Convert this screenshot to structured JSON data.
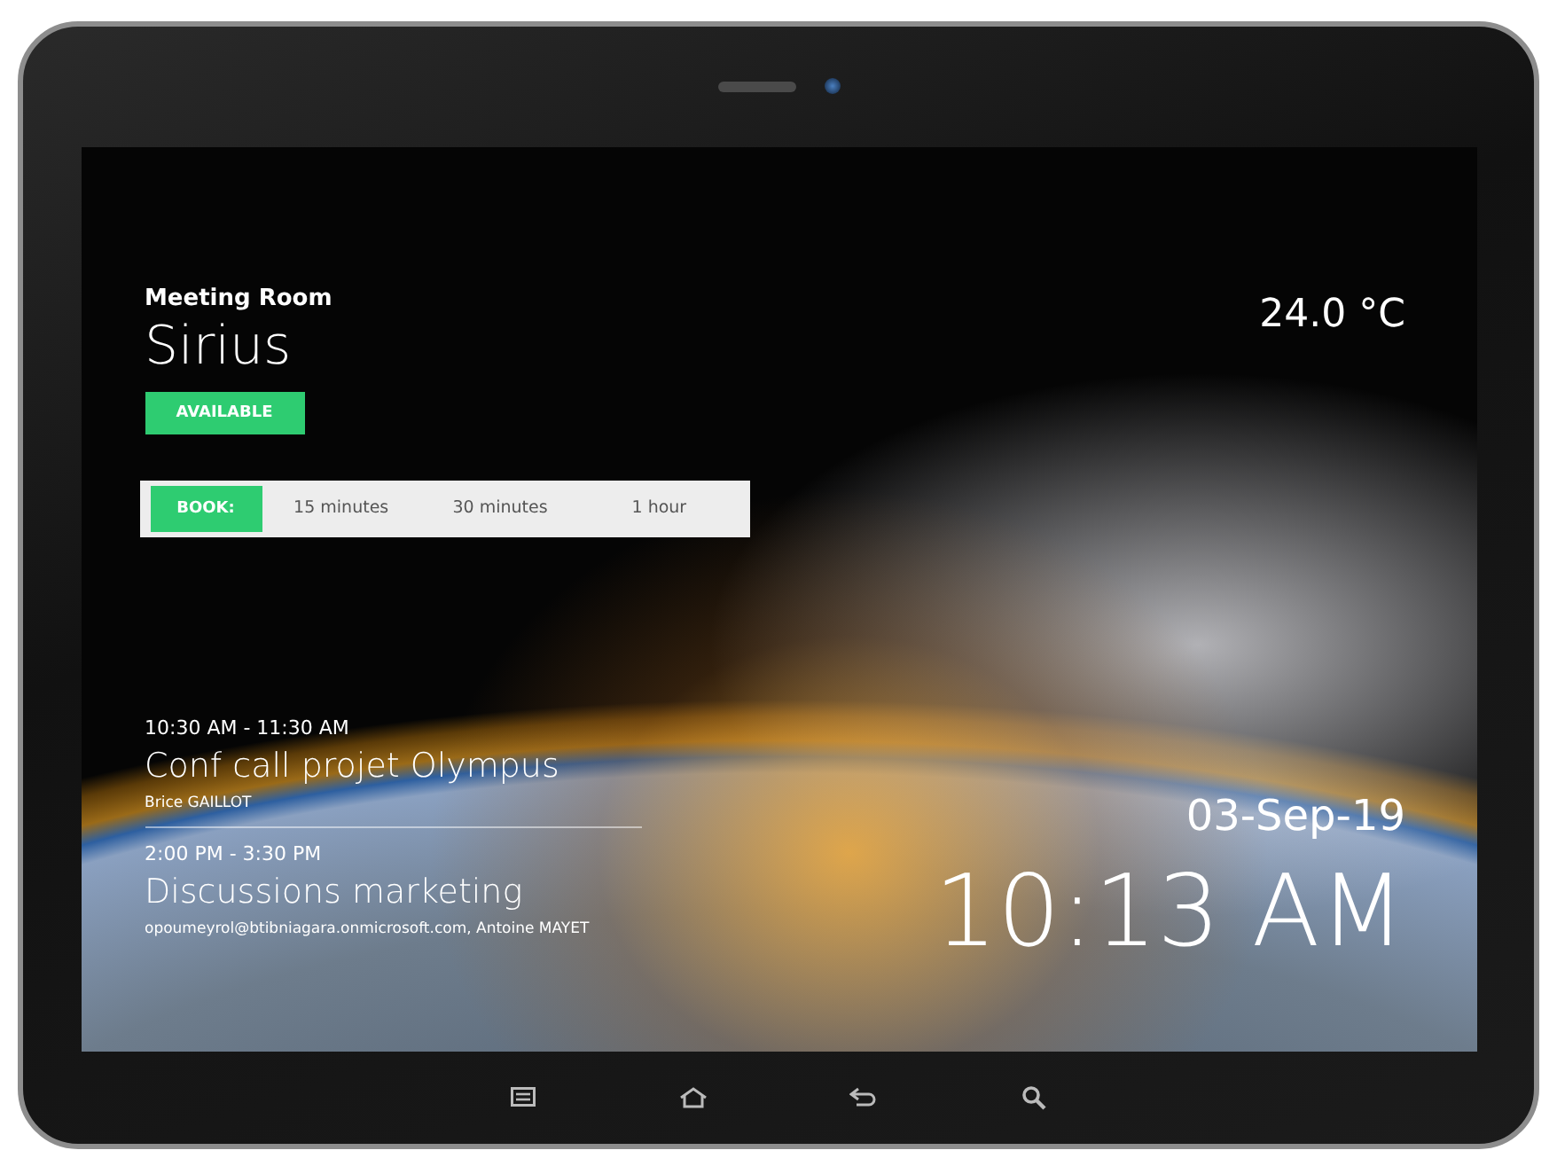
{
  "room": {
    "label": "Meeting Room",
    "name": "Sirius",
    "status": {
      "text": "AVAILABLE",
      "kind": "available"
    }
  },
  "book": {
    "label": "BOOK:",
    "options": [
      "15 minutes",
      "30 minutes",
      "1 hour"
    ]
  },
  "meetings": [
    {
      "time": "10:30 AM - 11:30 AM",
      "title": "Conf call projet Olympus",
      "attendees": "Brice GAILLOT"
    },
    {
      "time": "2:00 PM - 3:30 PM",
      "title": "Discussions marketing",
      "attendees": "opoumeyrol@btibniagara.onmicrosoft.com, Antoine MAYET"
    }
  ],
  "temperature": "24.0 °C",
  "date": "03-Sep-19",
  "time": "10:13 AM"
}
